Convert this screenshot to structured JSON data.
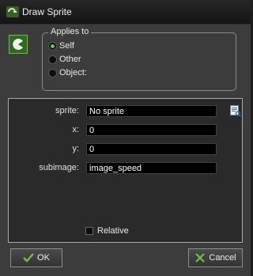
{
  "window": {
    "title": "Draw Sprite"
  },
  "applies_to": {
    "legend": "Applies to",
    "options": [
      {
        "label": "Self",
        "selected": true
      },
      {
        "label": "Other",
        "selected": false
      },
      {
        "label": "Object:",
        "selected": false
      }
    ]
  },
  "fields": {
    "sprite": {
      "label": "sprite:",
      "value": "No sprite"
    },
    "x": {
      "label": "x:",
      "value": "0"
    },
    "y": {
      "label": "y:",
      "value": "0"
    },
    "subimage": {
      "label": "subimage:",
      "value": "image_speed"
    }
  },
  "relative": {
    "label": "Relative",
    "checked": false
  },
  "buttons": {
    "ok": "OK",
    "cancel": "Cancel"
  },
  "colors": {
    "accent_green": "#6cc24a",
    "background": "#3c3c3c",
    "panel": "#2a2a2a"
  }
}
